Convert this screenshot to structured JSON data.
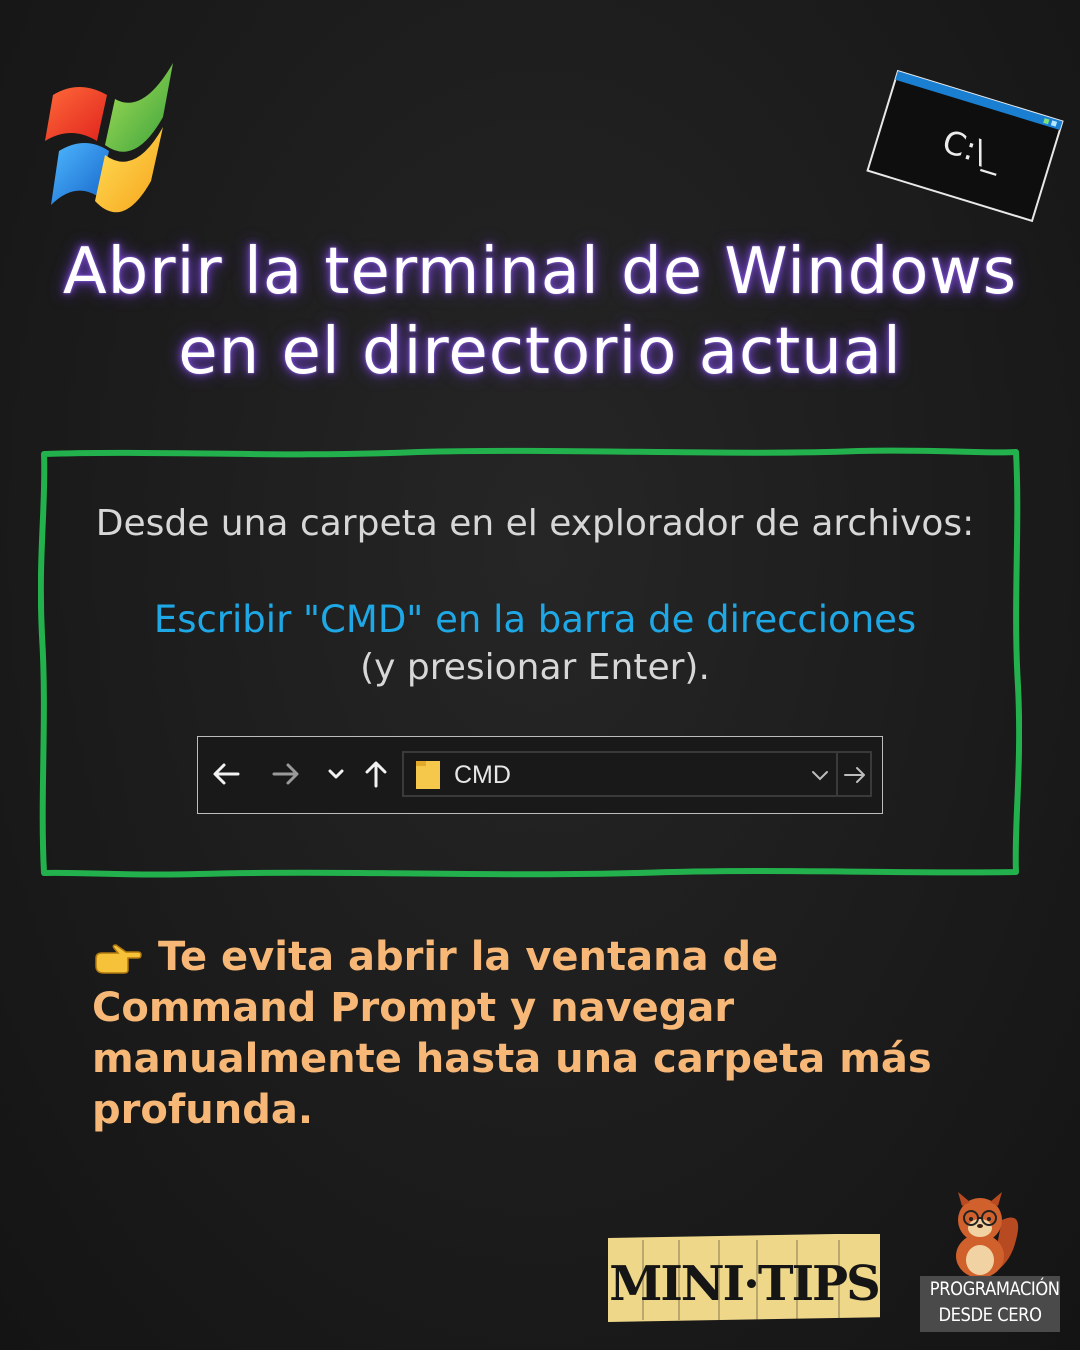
{
  "title": {
    "line1": "Abrir la terminal de Windows",
    "line2": "en el directorio actual"
  },
  "cmd_icon": {
    "prompt": "C:\\_"
  },
  "box": {
    "intro": "Desde una carpeta en el explorador de archivos:",
    "action": "Escribir \"CMD\" en la barra de direcciones",
    "note": "(y presionar Enter).",
    "border_color": "#22b14c"
  },
  "explorer": {
    "address_value": "CMD",
    "buttons": [
      "back-arrow-icon",
      "forward-arrow-icon",
      "recent-dropdown-icon",
      "up-arrow-icon"
    ]
  },
  "tip": {
    "icon": "pointing-hand-icon",
    "text": "Te evita abrir la ventana de Command Prompt y navegar manualmente hasta una carpeta más profunda."
  },
  "footer": {
    "minitips": "MINI·TIPS",
    "brand_line1": "PROGRAMACIÓN",
    "brand_line2": "DESDE CERO"
  },
  "colors": {
    "background": "#1c1c1c",
    "title_glow": "#7b4bd6",
    "accent_blue": "#1fa8e6",
    "tip_orange": "#f7b877",
    "box_green": "#22b14c"
  }
}
